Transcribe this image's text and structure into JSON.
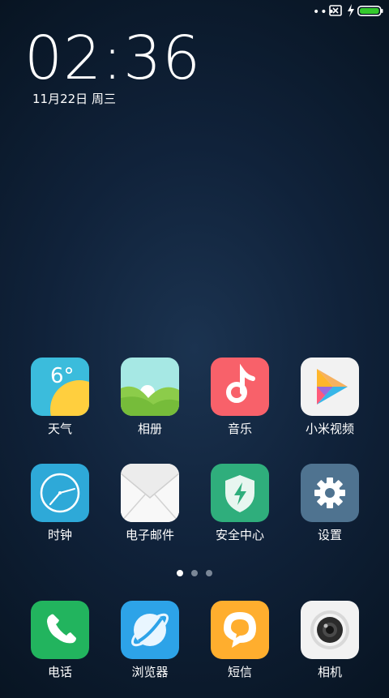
{
  "status_bar": {
    "overflow_dots": "•••",
    "icons": [
      "more-dots-icon",
      "no-sim-icon",
      "charging-bolt-icon",
      "battery-icon"
    ],
    "battery_color": "#34c92d"
  },
  "lock": {
    "time": "02:36",
    "date": "11月22日 周三"
  },
  "apps_row1": [
    {
      "label": "天气",
      "icon": "weather-icon",
      "temp": "6°"
    },
    {
      "label": "相册",
      "icon": "gallery-icon"
    },
    {
      "label": "音乐",
      "icon": "music-icon"
    },
    {
      "label": "小米视频",
      "icon": "video-play-icon"
    }
  ],
  "apps_row2": [
    {
      "label": "时钟",
      "icon": "clock-icon"
    },
    {
      "label": "电子邮件",
      "icon": "email-envelope-icon"
    },
    {
      "label": "安全中心",
      "icon": "security-shield-icon"
    },
    {
      "label": "设置",
      "icon": "settings-gear-icon"
    }
  ],
  "pager": {
    "pages": 3,
    "active": 0
  },
  "dock": [
    {
      "label": "电话",
      "icon": "phone-icon"
    },
    {
      "label": "浏览器",
      "icon": "browser-icon"
    },
    {
      "label": "短信",
      "icon": "message-bubble-icon"
    },
    {
      "label": "相机",
      "icon": "camera-icon"
    }
  ],
  "colors": {
    "weather_bg": "#3bbcdc",
    "gallery_bg": "#a6e8e4",
    "music_bg": "#f8616a",
    "video_bg": "#f2f2f2",
    "clock_bg": "#2ea9d8",
    "email_bg": "#f0f0f0",
    "security_bg": "#2fae7c",
    "settings_bg": "#4f7390",
    "phone_bg": "#22b45e",
    "browser_bg": "#2da3e8",
    "message_bg": "#ffae2e",
    "camera_bg": "#f2f2f2"
  }
}
